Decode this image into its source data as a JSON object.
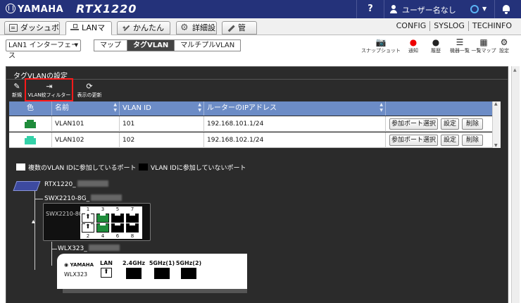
{
  "header": {
    "brand": "YAMAHA",
    "model": "RTX1220",
    "help": "?",
    "user": "ユーザー名なし",
    "status_color": "#5ab4f5"
  },
  "tabs": [
    {
      "label": "ダッシュボード",
      "icon": "document-icon",
      "active": false
    },
    {
      "label": "LANマップ",
      "icon": "network-icon",
      "active": true
    },
    {
      "label": "かんたん設定",
      "icon": "wand-icon",
      "active": false
    },
    {
      "label": "詳細設定",
      "icon": "gear-icon",
      "active": false
    },
    {
      "label": "管　理",
      "icon": "tools-icon",
      "active": false
    }
  ],
  "toplinks": [
    "CONFIG",
    "SYSLOG",
    "TECHINFO"
  ],
  "toolbar": {
    "interface": "LAN1 インターフェース",
    "views": [
      "マップ",
      "タグVLAN",
      "マルチプルVLAN"
    ],
    "active_view": "タグVLAN",
    "tools": [
      {
        "label": "スナップショット",
        "icon": "camera-icon"
      },
      {
        "label": "通知",
        "icon": "alert-icon"
      },
      {
        "label": "履歴",
        "icon": "history-icon"
      },
      {
        "label": "機器一覧",
        "icon": "list-icon"
      },
      {
        "label": "一覧マップ",
        "icon": "map-icon"
      },
      {
        "label": "設定",
        "icon": "settings-icon"
      }
    ]
  },
  "panel": {
    "title": "タグVLANの設定",
    "buttons": {
      "new": "新規",
      "filter": "VLAN絞フィルター",
      "refresh": "表示の更新"
    },
    "columns": [
      "色",
      "名前",
      "VLAN ID",
      "ルーターのIPアドレス"
    ],
    "rows": [
      {
        "color": "#1f8c3b",
        "name": "VLAN101",
        "vlan_id": "101",
        "ip": "192.168.101.1/24"
      },
      {
        "color": "#33d1a8",
        "name": "VLAN102",
        "vlan_id": "102",
        "ip": "192.168.102.1/24"
      }
    ],
    "row_buttons": {
      "select": "参加ポート選択",
      "settings": "設定",
      "delete": "削除"
    },
    "legend": {
      "multi": "複数のVLAN IDに参加しているポート",
      "none": "VLAN IDに参加していないポート"
    }
  },
  "topology": {
    "router": "RTX1220_",
    "switch_label": "SWX2210-8G_",
    "switch_model": "SWX2210-8G",
    "ports_top": [
      "1",
      "3",
      "5",
      "7"
    ],
    "ports_bottom": [
      "2",
      "4",
      "6",
      "8"
    ],
    "ap_label": "WLX323_",
    "ap_brand": "YAMAHA",
    "ap_model": "WLX323",
    "ap_ports": [
      "LAN",
      "2.4GHz",
      "5GHz(1)",
      "5GHz(2)"
    ]
  }
}
